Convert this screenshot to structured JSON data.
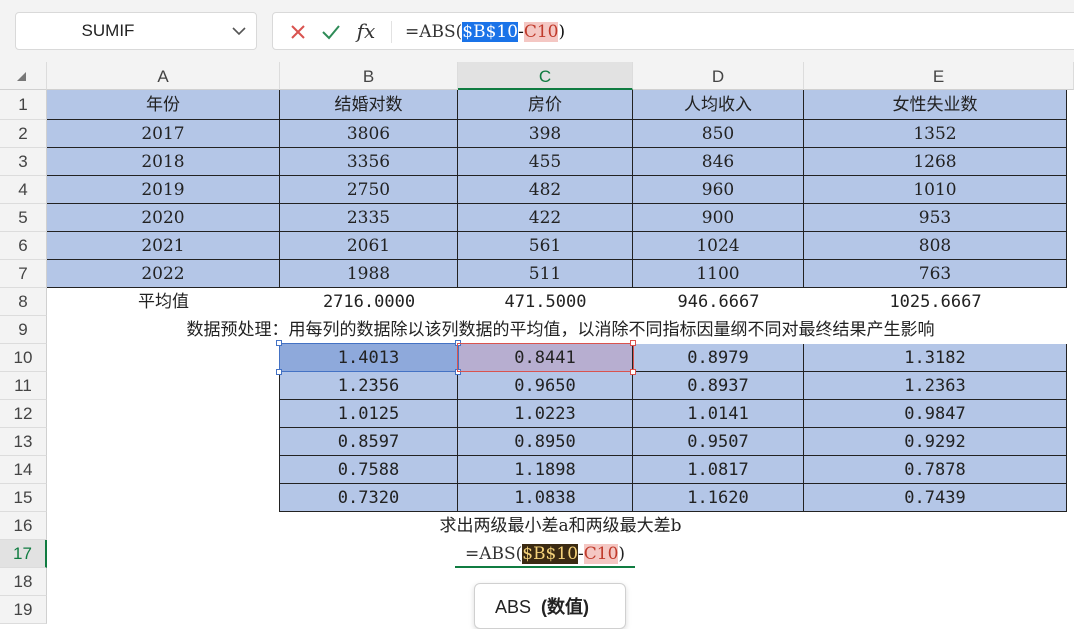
{
  "name_box": {
    "value": "SUMIF"
  },
  "formula_bar": {
    "prefix": "=ABS(",
    "ref1": "$B$10",
    "op": "-",
    "ref2": "C10",
    "suffix": ")"
  },
  "columns": [
    "A",
    "B",
    "C",
    "D",
    "E"
  ],
  "rows": [
    "1",
    "2",
    "3",
    "4",
    "5",
    "6",
    "7",
    "8",
    "9",
    "10",
    "11",
    "12",
    "13",
    "14",
    "15",
    "16",
    "17",
    "18",
    "19"
  ],
  "header_row": [
    "年份",
    "结婚对数",
    "房价",
    "人均收入",
    "女性失业数"
  ],
  "data_rows": [
    [
      "2017",
      "3806",
      "398",
      "850",
      "1352"
    ],
    [
      "2018",
      "3356",
      "455",
      "846",
      "1268"
    ],
    [
      "2019",
      "2750",
      "482",
      "960",
      "1010"
    ],
    [
      "2020",
      "2335",
      "422",
      "900",
      "953"
    ],
    [
      "2021",
      "2061",
      "561",
      "1024",
      "808"
    ],
    [
      "2022",
      "1988",
      "511",
      "1100",
      "763"
    ]
  ],
  "average_row": [
    "平均值",
    "2716.0000",
    "471.5000",
    "946.6667",
    "1025.6667"
  ],
  "note_row9": "数据预处理：用每列的数据除以该列数据的平均值，以消除不同指标因量纲不同对最终结果产生影响",
  "normalized_rows": [
    [
      "1.4013",
      "0.8441",
      "0.8979",
      "1.3182"
    ],
    [
      "1.2356",
      "0.9650",
      "0.8937",
      "1.2363"
    ],
    [
      "1.0125",
      "1.0223",
      "1.0141",
      "0.9847"
    ],
    [
      "0.8597",
      "0.8950",
      "0.9507",
      "0.9292"
    ],
    [
      "0.7588",
      "1.1898",
      "1.0817",
      "0.7878"
    ],
    [
      "0.7320",
      "1.0838",
      "1.1620",
      "0.7439"
    ]
  ],
  "note_row16": "求出两级最小差a和两级最大差b",
  "edit_cell": {
    "prefix": "=ABS(",
    "ref1": "$B$10",
    "op": "-",
    "ref2": "C10",
    "suffix": ")"
  },
  "tooltip": {
    "func": "ABS",
    "arg": "(数值)"
  },
  "icons": {
    "cancel": "close-icon",
    "confirm": "check-icon",
    "fx": "fx-icon"
  },
  "colors": {
    "table_fill": "#b4c6e7",
    "accent": "#107c41",
    "ref_blue": "#1a73e8",
    "ref_pink": "#f4c7c3"
  }
}
